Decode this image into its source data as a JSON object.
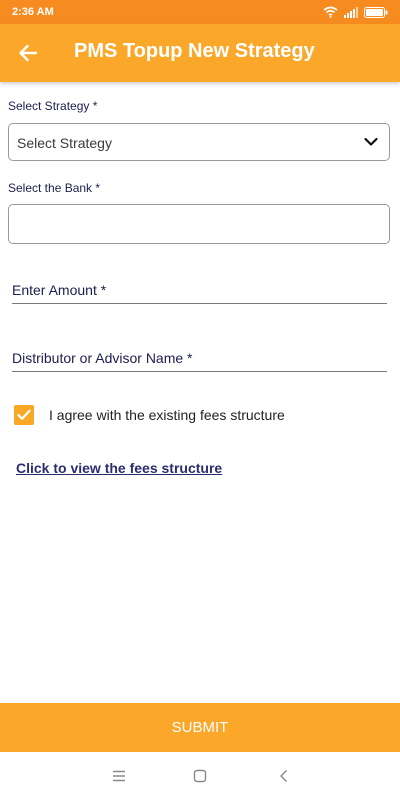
{
  "status_bar": {
    "time": "2:36 AM"
  },
  "app_bar": {
    "title": "PMS Topup New Strategy",
    "back_icon": "arrow-left-icon"
  },
  "form": {
    "strategy": {
      "label": "Select Strategy *",
      "value": "Select Strategy"
    },
    "bank": {
      "label": "Select the Bank *",
      "value": ""
    },
    "amount": {
      "label": "Enter Amount *"
    },
    "distributor": {
      "label": "Distributor or Advisor Name *"
    },
    "agree": {
      "label": "I agree with the existing fees structure",
      "checked": true
    },
    "fees_link": "Click to view the fees structure"
  },
  "submit_label": "SUBMIT",
  "colors": {
    "status_bar": "#F68B1F",
    "accent": "#FAA72A",
    "link": "#2b2d6e"
  },
  "nav_bar": {
    "icons": [
      "menu-icon",
      "home-icon",
      "back-icon"
    ]
  }
}
